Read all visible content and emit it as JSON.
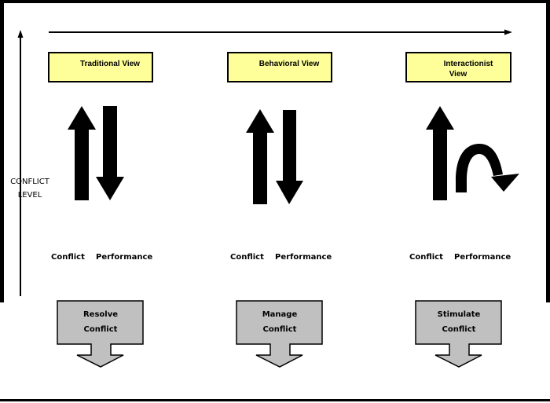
{
  "axis": {
    "y_label_line1": "CONFLICT",
    "y_label_line2": "LEVEL"
  },
  "views": [
    {
      "title_line1": "Traditional View",
      "title_line2": "",
      "conflict_label": "Conflict",
      "performance_label": "Performance",
      "action_line1": "Resolve",
      "action_line2": "Conflict"
    },
    {
      "title_line1": "Behavioral View",
      "title_line2": "",
      "conflict_label": "Conflict",
      "performance_label": "Performance",
      "action_line1": "Manage",
      "action_line2": "Conflict"
    },
    {
      "title_line1": "Interactionist",
      "title_line2": "View",
      "conflict_label": "Conflict",
      "performance_label": "Performance",
      "action_line1": "Stimulate",
      "action_line2": "Conflict"
    }
  ],
  "colors": {
    "title_box": "#ffff99",
    "action_box": "#c0c0c0",
    "border": "#000000"
  }
}
